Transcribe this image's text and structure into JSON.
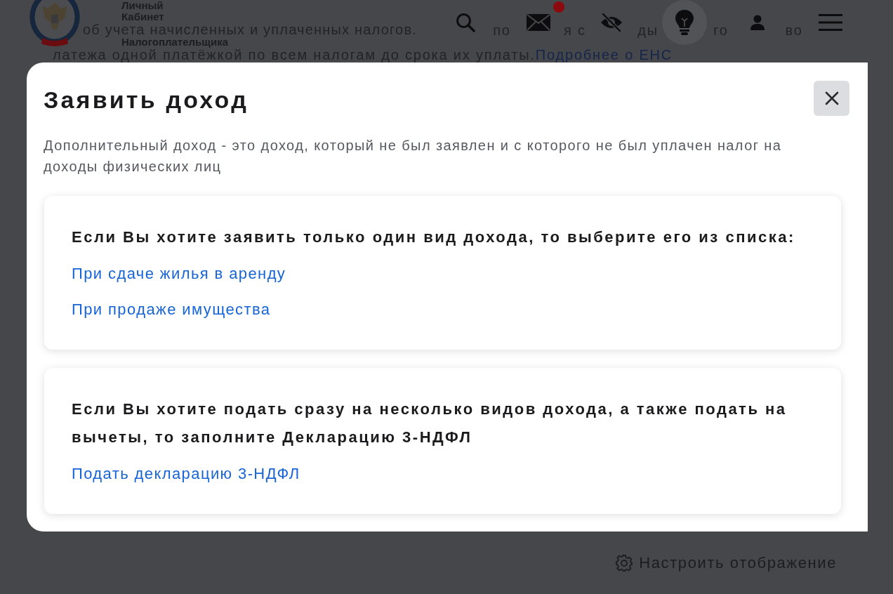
{
  "background_page": {
    "logo_lines": [
      "Личный",
      "Кабинет",
      "Налогоплательщика"
    ],
    "mail_notification": true,
    "intro_line": "об учета начисленных и уплаченных налогов.",
    "intro_fragments": [
      "по",
      "я с",
      "ды",
      "го",
      "во"
    ],
    "intro_line_2": "латежа одной платёжкой по всем налогам до срока их уплаты.",
    "intro_link": "Подробнее о ЕНС",
    "display_settings_link": "Настроить отображение"
  },
  "dialog": {
    "title": "Заявить доход",
    "description": "Дополнительный доход - это доход, который не был заявлен и с которого не был уплачен налог на доходы физических лиц",
    "sections": [
      {
        "heading": "Если Вы хотите заявить только один вид дохода, то выберите его из списка:",
        "links": [
          "При сдаче жилья в аренду",
          "При продаже имущества"
        ]
      },
      {
        "heading": "Если Вы хотите подать сразу на несколько видов дохода, а также подать на вычеты, то заполните Декларацию 3-НДФЛ",
        "links": [
          "Подать декларацию 3-НДФЛ"
        ]
      }
    ]
  }
}
